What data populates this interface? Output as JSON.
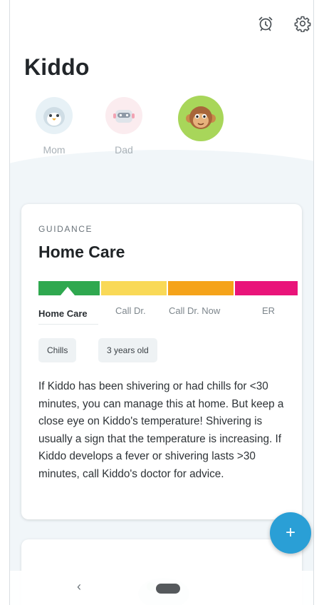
{
  "header": {
    "title": "Kiddo",
    "alarm_icon": "alarm-clock-icon",
    "settings_icon": "gear-icon"
  },
  "profiles": [
    {
      "label": "Mom",
      "icon": "penguin-avatar",
      "color": "#e7f1f6"
    },
    {
      "label": "Dad",
      "icon": "robot-avatar",
      "color": "#fbecef"
    },
    {
      "label": "",
      "icon": "monkey-avatar",
      "color": "#a8d65a"
    }
  ],
  "card": {
    "eyebrow": "GUIDANCE",
    "title": "Home Care",
    "levels": [
      {
        "label": "Home Care",
        "color": "#2fa84f",
        "active": true
      },
      {
        "label": "Call Dr.",
        "color": "#f9d957",
        "active": false
      },
      {
        "label": "Call Dr. Now",
        "color": "#f5a31a",
        "active": false
      },
      {
        "label": "ER",
        "color": "#e9147a",
        "active": false
      }
    ],
    "tags": [
      "Chills",
      "3 years old"
    ],
    "body": "If Kiddo has been shivering or had chills for <30 minutes, you can manage this at home. But keep a close eye on Kiddo's temperature! Shivering is usually a sign that the temperature is increasing. If Kiddo develops a fever or shivering lasts >30 minutes, call Kiddo's doctor for advice."
  },
  "fab": {
    "label": "+"
  },
  "nav": {
    "back": "‹"
  },
  "colors": {
    "accent": "#2a9fd6",
    "background": "#f1f6f9"
  }
}
